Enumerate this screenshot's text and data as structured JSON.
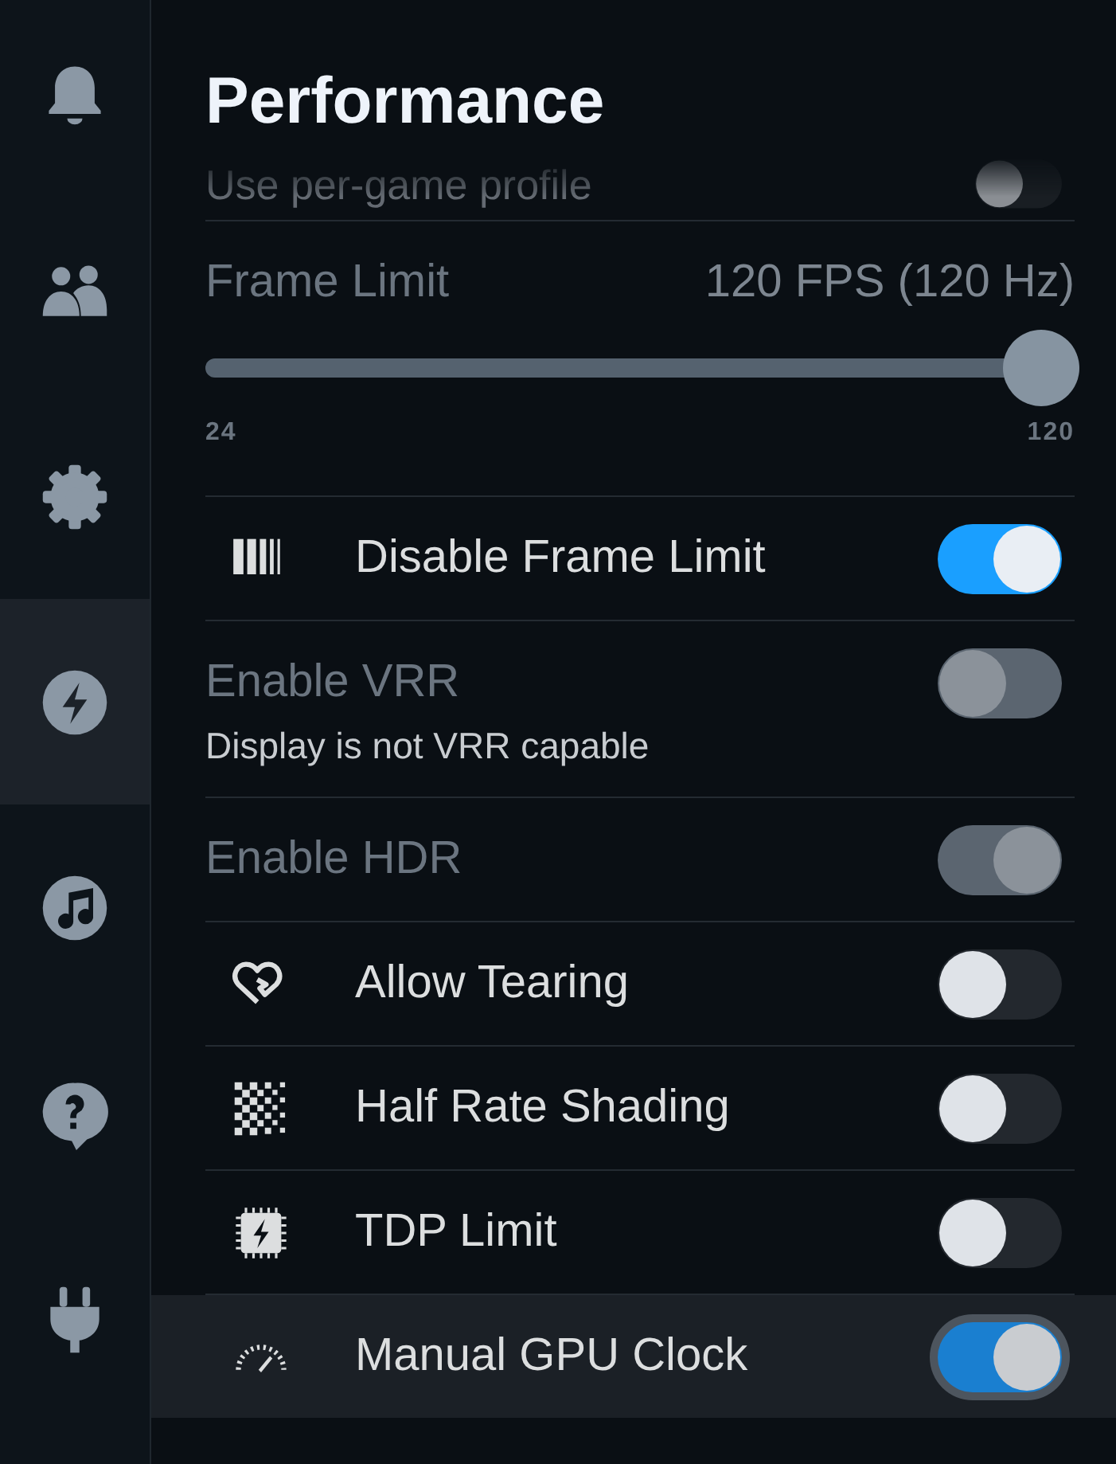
{
  "title": "Performance",
  "sidebar": {
    "items": [
      {
        "kind": "bell",
        "selected": false
      },
      {
        "kind": "friends",
        "selected": false
      },
      {
        "kind": "gear",
        "selected": false
      },
      {
        "kind": "bolt",
        "selected": true
      },
      {
        "kind": "music",
        "selected": false
      },
      {
        "kind": "help",
        "selected": false
      },
      {
        "kind": "plug",
        "selected": false
      }
    ]
  },
  "scrolled_row": {
    "label": "Use per-game profile",
    "on": false
  },
  "frame_limit": {
    "label": "Frame Limit",
    "reading": "120 FPS (120 Hz)",
    "level": 1,
    "min_label": "24",
    "max_label": "120"
  },
  "settings": [
    {
      "label": "Disable Frame Limit",
      "on": true,
      "disabled": false,
      "focused": false
    },
    {
      "label": "Enable VRR",
      "on": false,
      "disabled": true,
      "focused": false,
      "hint": "Display is not VRR capable"
    },
    {
      "label": "Enable HDR",
      "on": true,
      "disabled": true,
      "focused": false
    },
    {
      "label": "Allow Tearing",
      "on": false,
      "disabled": false,
      "focused": false
    },
    {
      "label": "Half Rate Shading",
      "on": false,
      "disabled": false,
      "focused": false
    },
    {
      "label": "TDP Limit",
      "on": false,
      "disabled": false,
      "focused": false
    },
    {
      "label": "Manual GPU Clock",
      "on": true,
      "disabled": false,
      "focused": true
    }
  ]
}
